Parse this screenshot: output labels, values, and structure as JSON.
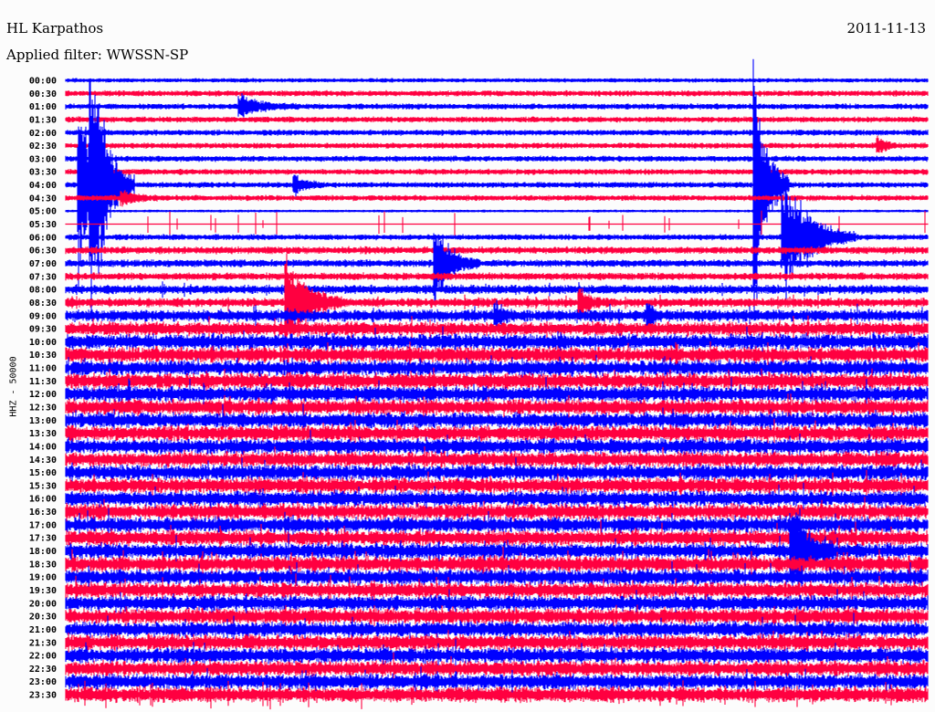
{
  "header": {
    "station": "HL Karpathos",
    "filter": "Applied filter: WWSSN-SP",
    "date": "2011-11-13"
  },
  "chart_data": {
    "type": "line",
    "title": "HL Karpathos",
    "ylabel": "HHZ - 50000",
    "minutes_per_row": 30,
    "row_labels": [
      "00:00",
      "00:30",
      "01:00",
      "01:30",
      "02:00",
      "02:30",
      "03:00",
      "03:30",
      "04:00",
      "04:30",
      "05:00",
      "05:30",
      "06:00",
      "06:30",
      "07:00",
      "07:30",
      "08:00",
      "08:30",
      "09:00",
      "09:30",
      "10:00",
      "10:30",
      "11:00",
      "11:30",
      "12:00",
      "12:30",
      "13:00",
      "13:30",
      "14:00",
      "14:30",
      "15:00",
      "15:30",
      "16:00",
      "16:30",
      "17:00",
      "17:30",
      "18:00",
      "18:30",
      "19:00",
      "19:30",
      "20:00",
      "20:30",
      "21:00",
      "21:30",
      "22:00",
      "22:30",
      "23:00",
      "23:30"
    ],
    "row_colors": [
      "#0000ff",
      "#ff0040"
    ],
    "noise_level": [
      2,
      3,
      3,
      3,
      3,
      3,
      3,
      3,
      3,
      3,
      1,
      0,
      3,
      4,
      4,
      4,
      5,
      5,
      7,
      8,
      9,
      9,
      9,
      9,
      9,
      9,
      9,
      9,
      9,
      9,
      9,
      9,
      9,
      9,
      9,
      9,
      9,
      9,
      9,
      9,
      9,
      9,
      9,
      9,
      9,
      9,
      9,
      9
    ],
    "events": [
      {
        "row": 8,
        "minute": 0.9,
        "amplitude": 180,
        "duration": 1.5
      },
      {
        "row": 8,
        "minute": 0.5,
        "amplitude": 120,
        "duration": 1
      },
      {
        "row": 2,
        "minute": 6.1,
        "amplitude": 14,
        "duration": 2
      },
      {
        "row": 8,
        "minute": 8.0,
        "amplitude": 14,
        "duration": 1
      },
      {
        "row": 8,
        "minute": 24.0,
        "amplitude": 160,
        "duration": 1.2
      },
      {
        "row": 9,
        "minute": 2.0,
        "amplitude": 8,
        "duration": 1.5
      },
      {
        "row": 12,
        "minute": 25.0,
        "amplitude": 80,
        "duration": 2.5
      },
      {
        "row": 14,
        "minute": 12.9,
        "amplitude": 45,
        "duration": 1.5
      },
      {
        "row": 17,
        "minute": 7.7,
        "amplitude": 60,
        "duration": 2
      },
      {
        "row": 17,
        "minute": 17.9,
        "amplitude": 16,
        "duration": 1
      },
      {
        "row": 18,
        "minute": 15.0,
        "amplitude": 14,
        "duration": 0.6
      },
      {
        "row": 18,
        "minute": 20.3,
        "amplitude": 14,
        "duration": 0.6
      },
      {
        "row": 5,
        "minute": 28.3,
        "amplitude": 10,
        "duration": 0.8
      },
      {
        "row": 36,
        "minute": 25.3,
        "amplitude": 60,
        "duration": 1.5
      }
    ]
  }
}
